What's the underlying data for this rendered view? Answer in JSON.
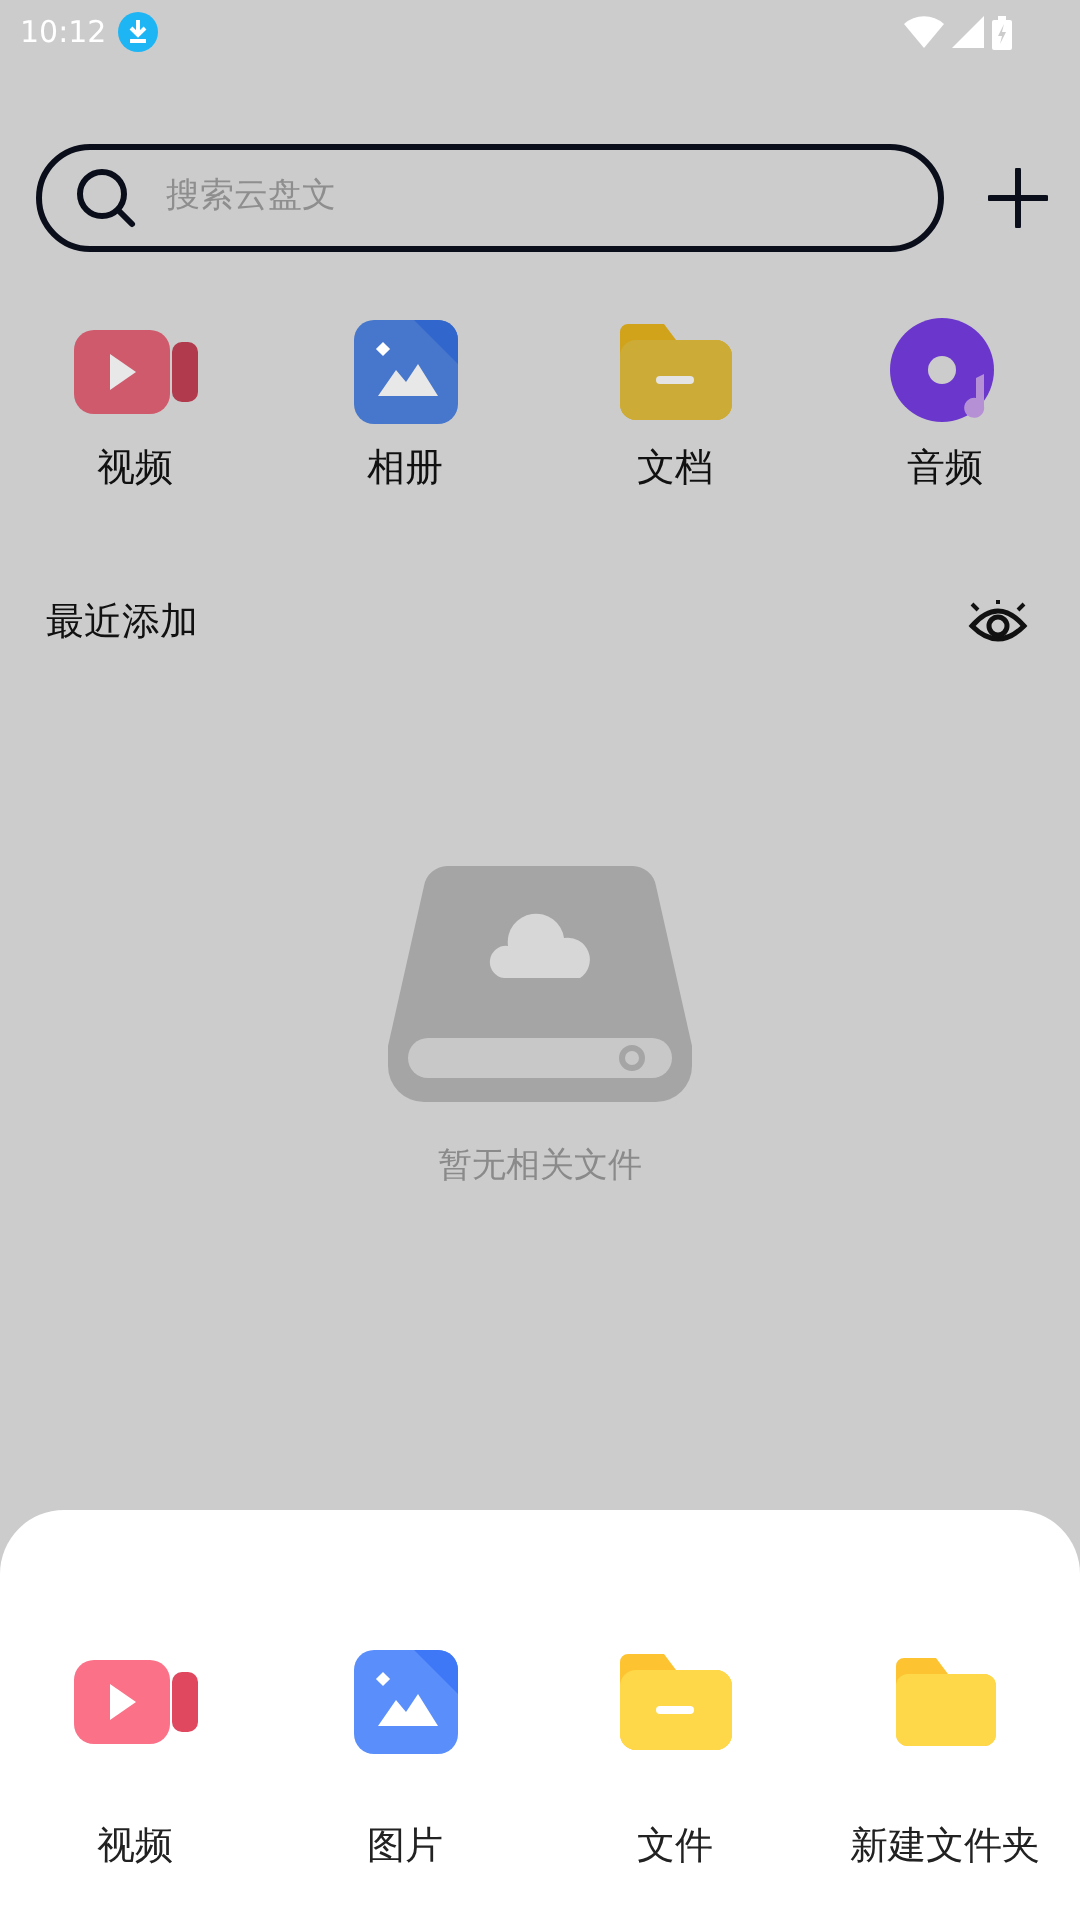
{
  "status_bar": {
    "time": "10:12"
  },
  "search": {
    "placeholder": "搜索云盘文"
  },
  "categories": [
    {
      "label": "视频",
      "kind": "video"
    },
    {
      "label": "相册",
      "kind": "photo"
    },
    {
      "label": "文档",
      "kind": "document"
    },
    {
      "label": "音频",
      "kind": "music"
    }
  ],
  "recent": {
    "title": "最近添加"
  },
  "empty_state": {
    "message": "暂无相关文件"
  },
  "add_sheet": {
    "items": [
      {
        "label": "视频",
        "kind": "video"
      },
      {
        "label": "图片",
        "kind": "photo"
      },
      {
        "label": "文件",
        "kind": "document"
      },
      {
        "label": "新建文件夹",
        "kind": "folder"
      }
    ]
  }
}
